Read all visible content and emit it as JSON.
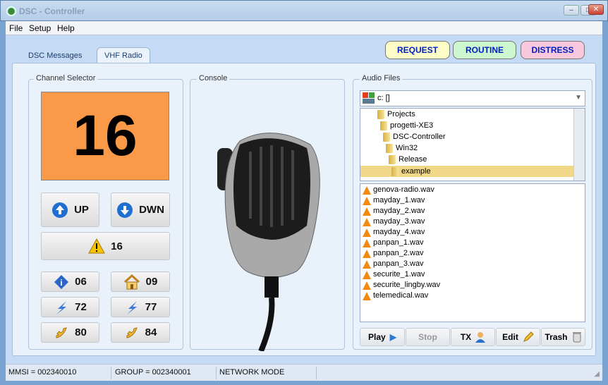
{
  "window": {
    "title": "DSC - Controller",
    "minimize": "–",
    "maximize": "□",
    "close": "✕"
  },
  "menu": [
    "File",
    "Setup",
    "Help"
  ],
  "tabs": [
    "DSC Messages",
    "VHF Radio"
  ],
  "header_buttons": {
    "request": "REQUEST",
    "routine": "ROUTINE",
    "distress": "DISTRESS",
    "colors": {
      "request": "#fdfdc8",
      "routine": "#ccf7cf",
      "distress": "#f9c8dc"
    }
  },
  "channel_selector": {
    "label": "Channel Selector",
    "channel": "16",
    "up": "UP",
    "down": "DWN",
    "emergency": "16",
    "presets": [
      {
        "icon": "info-icon",
        "value": "06"
      },
      {
        "icon": "home-icon",
        "value": "09"
      },
      {
        "icon": "lightning-icon",
        "value": "72"
      },
      {
        "icon": "lightning-icon",
        "value": "77"
      },
      {
        "icon": "phone-icon",
        "value": "80"
      },
      {
        "icon": "phone-icon",
        "value": "84"
      }
    ]
  },
  "console": {
    "label": "Console"
  },
  "audio": {
    "label": "Audio Files",
    "drive": "c: []",
    "tree": [
      "Projects",
      "progetti-XE3",
      "DSC-Controller",
      "Win32",
      "Release",
      "example"
    ],
    "selected_folder": "example",
    "files": [
      "genova-radio.wav",
      "mayday_1.wav",
      "mayday_2.wav",
      "mayday_3.wav",
      "mayday_4.wav",
      "panpan_1.wav",
      "panpan_2.wav",
      "panpan_3.wav",
      "securite_1.wav",
      "securite_lingby.wav",
      "telemedical.wav"
    ],
    "buttons": {
      "play": "Play",
      "stop": "Stop",
      "tx": "TX",
      "edit": "Edit",
      "trash": "Trash"
    }
  },
  "status": {
    "mmsi": "MMSI = 002340010",
    "group": "GROUP = 002340001",
    "mode": "NETWORK MODE"
  }
}
